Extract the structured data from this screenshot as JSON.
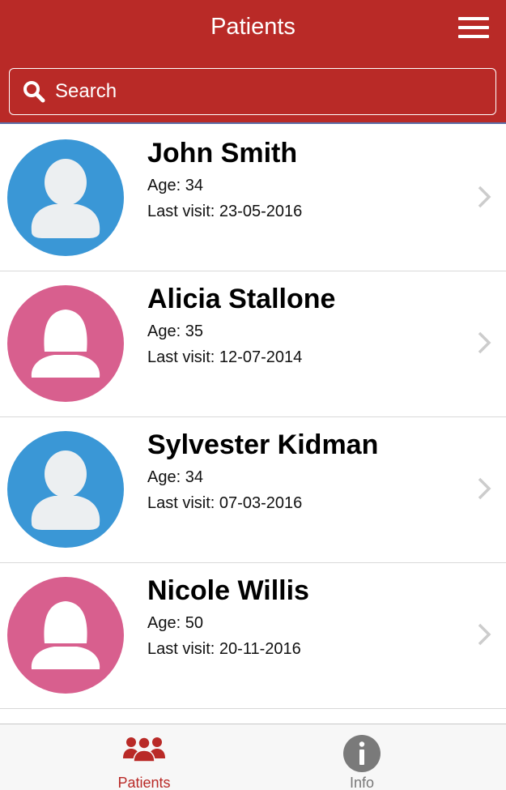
{
  "header": {
    "title": "Patients",
    "menu_icon": "hamburger-menu-icon"
  },
  "search": {
    "placeholder": "Search",
    "icon": "search-icon"
  },
  "patients": [
    {
      "name": "John Smith",
      "age": "Age: 34",
      "last_visit": "Last visit: 23-05-2016",
      "avatar": "male-avatar-icon"
    },
    {
      "name": "Alicia Stallone",
      "age": "Age: 35",
      "last_visit": "Last visit: 12-07-2014",
      "avatar": "female-avatar-icon"
    },
    {
      "name": "Sylvester Kidman",
      "age": "Age: 34",
      "last_visit": "Last visit: 07-03-2016",
      "avatar": "male-avatar-icon"
    },
    {
      "name": "Nicole Willis",
      "age": "Age: 50",
      "last_visit": "Last visit: 20-11-2016",
      "avatar": "female-avatar-icon"
    }
  ],
  "tabs": [
    {
      "label": "Patients",
      "icon": "patients-group-icon",
      "active": true
    },
    {
      "label": "Info",
      "icon": "info-icon",
      "active": false
    }
  ],
  "colors": {
    "header": "#b92a27",
    "male_avatar": "#3a97d6",
    "female_avatar": "#d85f8e",
    "silhouette": "#eceff1",
    "active_tab": "#b92a27",
    "inactive_tab": "#777777",
    "chevron": "#cccccc"
  }
}
